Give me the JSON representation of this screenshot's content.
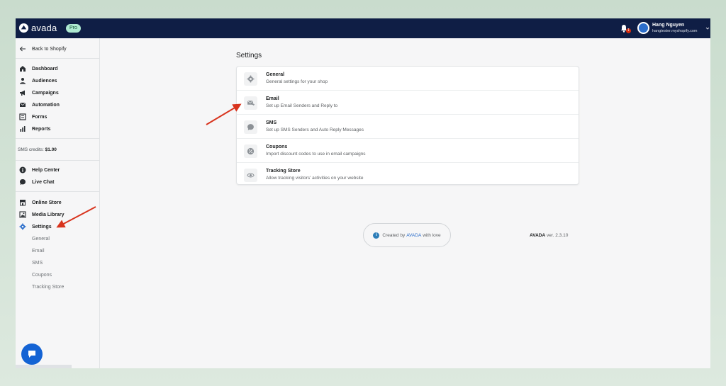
{
  "header": {
    "logo_text": "avada",
    "plan_badge": "Pro",
    "notification_count": "1",
    "user_name": "Hang Nguyen",
    "user_store": "hangtester.myshopify.com"
  },
  "sidebar": {
    "back_label": "Back to Shopify",
    "main_items": [
      {
        "label": "Dashboard",
        "icon": "home-icon"
      },
      {
        "label": "Audiences",
        "icon": "person-icon"
      },
      {
        "label": "Campaigns",
        "icon": "megaphone-icon"
      },
      {
        "label": "Automation",
        "icon": "envelope-icon"
      },
      {
        "label": "Forms",
        "icon": "forms-icon"
      },
      {
        "label": "Reports",
        "icon": "bar-chart-icon"
      }
    ],
    "credits_label": "SMS credits:",
    "credits_value": "$1.00",
    "help_items": [
      {
        "label": "Help Center",
        "icon": "info-icon"
      },
      {
        "label": "Live Chat",
        "icon": "chat-icon"
      }
    ],
    "store_items": [
      {
        "label": "Online Store",
        "icon": "store-icon"
      },
      {
        "label": "Media Library",
        "icon": "image-icon"
      },
      {
        "label": "Settings",
        "icon": "gear-icon"
      }
    ],
    "settings_sub": [
      "General",
      "Email",
      "SMS",
      "Coupons",
      "Tracking Store"
    ]
  },
  "main": {
    "title": "Settings",
    "settings": [
      {
        "title": "General",
        "desc": "General settings for your shop",
        "icon": "gear-icon"
      },
      {
        "title": "Email",
        "desc": "Set up Email Senders and Reply to",
        "icon": "email-send-icon"
      },
      {
        "title": "SMS",
        "desc": "Set up SMS Senders and Auto Reply Messages",
        "icon": "chat-icon"
      },
      {
        "title": "Coupons",
        "desc": "Import discount codes to use in email campaigns",
        "icon": "discount-icon"
      },
      {
        "title": "Tracking Store",
        "desc": "Allow tracking visitors' activities on your website",
        "icon": "eye-icon"
      }
    ],
    "footer": {
      "prefix": "Created by",
      "brand": "AVADA",
      "suffix": "with love",
      "version_brand": "AVADA",
      "version_text": "ver. 2.3.10"
    }
  },
  "colors": {
    "topbar": "#0f1e45",
    "accent": "#2c6ecb",
    "annotation_arrow": "#d8341e",
    "background": "#c9dccd"
  }
}
